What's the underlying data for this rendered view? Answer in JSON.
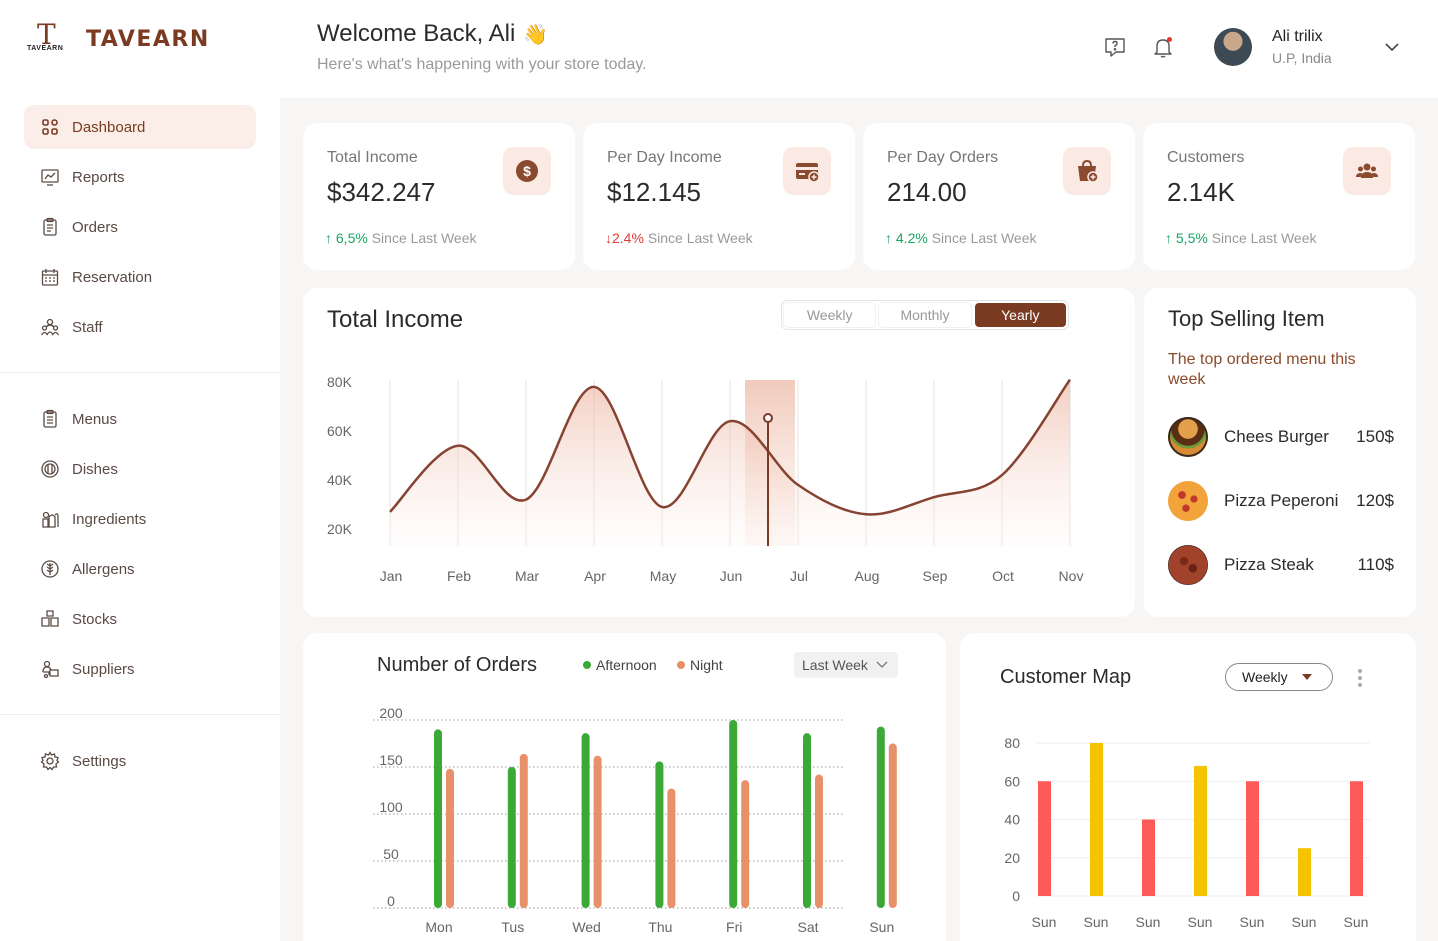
{
  "brand": {
    "mark": "T",
    "small": "TAVEARN",
    "name": "TAVEARN"
  },
  "nav_primary": [
    {
      "label": "Dashboard",
      "icon": "dashboard-grid-icon",
      "active": true
    },
    {
      "label": "Reports",
      "icon": "reports-icon"
    },
    {
      "label": "Orders",
      "icon": "clipboard-icon"
    },
    {
      "label": "Reservation",
      "icon": "calendar-icon"
    },
    {
      "label": "Staff",
      "icon": "staff-icon"
    }
  ],
  "nav_secondary": [
    {
      "label": "Menus",
      "icon": "menu-list-icon"
    },
    {
      "label": "Dishes",
      "icon": "dish-icon"
    },
    {
      "label": "Ingredients",
      "icon": "ingredients-icon"
    },
    {
      "label": "Allergens",
      "icon": "allergens-icon"
    },
    {
      "label": "Stocks",
      "icon": "stocks-boxes-icon"
    },
    {
      "label": "Suppliers",
      "icon": "suppliers-icon"
    }
  ],
  "nav_settings": {
    "label": "Settings",
    "icon": "gear-icon"
  },
  "header": {
    "welcome": "Welcome Back, Ali",
    "wave": "👋",
    "subtitle": "Here's what's happening with your store today.",
    "user_name": "Ali trilix",
    "user_location": "U.P, India"
  },
  "stats": [
    {
      "label": "Total Income",
      "value": "$342.247",
      "change": "6,5%",
      "direction": "up",
      "note": "Since Last Week",
      "icon": "dollar-icon"
    },
    {
      "label": "Per Day Income",
      "value": "$12.145",
      "change": "2.4%",
      "direction": "down",
      "note": "Since Last Week",
      "icon": "card-add-icon"
    },
    {
      "label": "Per Day Orders",
      "value": "214.00",
      "change": "4.2%",
      "direction": "up",
      "note": "Since Last Week",
      "icon": "bag-add-icon"
    },
    {
      "label": "Customers",
      "value": "2.14K",
      "change": "5,5%",
      "direction": "up",
      "note": "Since Last Week",
      "icon": "users-icon"
    }
  ],
  "income_panel": {
    "title": "Total Income",
    "tabs": [
      "Weekly",
      "Monthly",
      "Yearly"
    ],
    "active_tab": "Yearly"
  },
  "top_selling": {
    "title": "Top Selling Item",
    "subtitle": "The top ordered menu this week",
    "items": [
      {
        "name": "Chees Burger",
        "price": "150$"
      },
      {
        "name": "Pizza Peperoni",
        "price": "120$"
      },
      {
        "name": "Pizza Steak",
        "price": "110$"
      }
    ]
  },
  "orders_panel": {
    "title": "Number of Orders",
    "legend": [
      "Afternoon",
      "Night"
    ],
    "filter": "Last Week"
  },
  "map_panel": {
    "title": "Customer Map",
    "filter": "Weekly"
  },
  "colors": {
    "brand": "#7a3b22",
    "accent_soft": "#fbeee8",
    "up": "#18a564",
    "down": "#e53935",
    "afternoon": "#3aa935",
    "night": "#e8906a",
    "map_red": "#ff5a5a",
    "map_yellow": "#f5c400"
  },
  "chart_data": [
    {
      "type": "area",
      "title": "Total Income",
      "categories": [
        "Jan",
        "Feb",
        "Mar",
        "Apr",
        "May",
        "Jun",
        "Jul",
        "Aug",
        "Sep",
        "Oct",
        "Nov"
      ],
      "values": [
        27000,
        54000,
        32000,
        78000,
        29000,
        64000,
        38000,
        26000,
        33000,
        42000,
        81000
      ],
      "y_ticks": [
        "80K",
        "60K",
        "40K",
        "20K"
      ],
      "ylim": [
        15000,
        85000
      ],
      "highlight_category": "Jun",
      "grid": true
    },
    {
      "type": "bar",
      "title": "Number of Orders",
      "categories": [
        "Mon",
        "Tus",
        "Wed",
        "Thu",
        "Fri",
        "Sat",
        "Sun"
      ],
      "series": [
        {
          "name": "Afternoon",
          "values": [
            190,
            150,
            186,
            156,
            200,
            186,
            193
          ]
        },
        {
          "name": "Night",
          "values": [
            148,
            164,
            162,
            127,
            136,
            142,
            175
          ]
        }
      ],
      "y_ticks": [
        "200",
        "150",
        "100",
        "50",
        "0"
      ],
      "ylim": [
        0,
        200
      ],
      "grid": true
    },
    {
      "type": "bar",
      "title": "Customer Map",
      "categories": [
        "Sun",
        "Sun",
        "Sun",
        "Sun",
        "Sun",
        "Sun",
        "Sun"
      ],
      "values": [
        60,
        80,
        40,
        68,
        60,
        25,
        60
      ],
      "bar_colors": [
        "#ff5a5a",
        "#f5c400",
        "#ff5a5a",
        "#f5c400",
        "#ff5a5a",
        "#f5c400",
        "#ff5a5a"
      ],
      "y_ticks": [
        "80",
        "60",
        "40",
        "20",
        "0"
      ],
      "ylim": [
        0,
        80
      ],
      "grid": true
    }
  ]
}
